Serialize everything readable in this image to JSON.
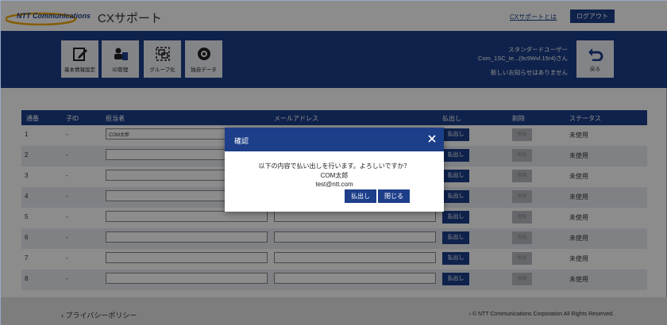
{
  "header": {
    "logo_text": "NTT Communications",
    "title": "CXサポート",
    "about_link": "CXサポートとは",
    "logout_label": "ログアウト"
  },
  "toolbar": [
    {
      "label": "基本情報設定",
      "icon": "edit-icon"
    },
    {
      "label": "ID管理",
      "icon": "id-card-icon"
    },
    {
      "label": "グループ化",
      "icon": "group-icon"
    },
    {
      "label": "独自データ",
      "icon": "data-icon"
    }
  ],
  "user": {
    "role": "スタンダードユーザー",
    "name": "Com_1SC_te...(9c9Wvl.15r4)さん",
    "notice": "新しいお知らせはありません"
  },
  "back_label": "戻る",
  "table": {
    "columns": [
      "通番",
      "子ID",
      "担当者",
      "メールアドレス",
      "払出し",
      "削除",
      "ステータス"
    ],
    "rows": [
      {
        "no": "1",
        "child_id": "-",
        "person": "COM太郎",
        "email": "",
        "pay": "払出し",
        "delete": "削除",
        "status": "未使用"
      },
      {
        "no": "2",
        "child_id": "-",
        "person": "",
        "email": "",
        "pay": "払出し",
        "delete": "削除",
        "status": "未使用"
      },
      {
        "no": "3",
        "child_id": "-",
        "person": "",
        "email": "",
        "pay": "払出し",
        "delete": "削除",
        "status": "未使用"
      },
      {
        "no": "4",
        "child_id": "-",
        "person": "",
        "email": "",
        "pay": "払出し",
        "delete": "削除",
        "status": "未使用"
      },
      {
        "no": "5",
        "child_id": "-",
        "person": "",
        "email": "",
        "pay": "払出し",
        "delete": "削除",
        "status": "未使用"
      },
      {
        "no": "6",
        "child_id": "-",
        "person": "",
        "email": "",
        "pay": "払出し",
        "delete": "削除",
        "status": "未使用"
      },
      {
        "no": "7",
        "child_id": "-",
        "person": "",
        "email": "",
        "pay": "払出し",
        "delete": "削除",
        "status": "未使用"
      },
      {
        "no": "8",
        "child_id": "-",
        "person": "",
        "email": "",
        "pay": "払出し",
        "delete": "削除",
        "status": "未使用"
      }
    ]
  },
  "footer": {
    "privacy": "プライバシーポリシー",
    "copyright": "© NTT Communications Corporation All Rights Reserved."
  },
  "dialog": {
    "title": "確認",
    "message": "以下の内容で払い出しを行います。よろしいですか？",
    "person": "COM太郎",
    "email": "test@ntt.com",
    "confirm_label": "払出し",
    "close_label": "閉じる"
  },
  "colors": {
    "brand": "#1d3f8a",
    "accent": "#f0a800"
  }
}
